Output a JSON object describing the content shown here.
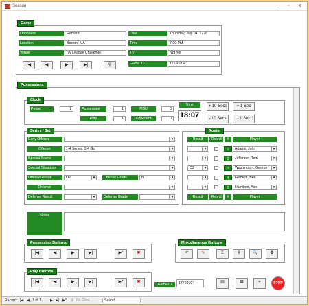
{
  "window": {
    "title": "Season",
    "min": "_",
    "max": "▫",
    "close": "x"
  },
  "game": {
    "tab": "Game",
    "opponent_label": "Opponent",
    "opponent": "Harvard",
    "location_label": "Location",
    "location": "Boston, MA",
    "venue_label": "Venue",
    "venue": "Ivy League Challenge",
    "date_label": "Date",
    "date": "Thursday, July 04, 1776",
    "time_label": "Time",
    "time": "7:00 PM",
    "tv_label": "TV",
    "tv": "Not Yet",
    "gameid_label": "Game ID",
    "gameid": "17760704",
    "nav": {
      "first": "|◀",
      "prev": "◀",
      "next": "▶",
      "last": "▶|",
      "find": "⚲"
    }
  },
  "possessions": {
    "tab": "Possessions"
  },
  "clock": {
    "tab": "Clock",
    "period_label": "Period",
    "period": "1",
    "possession_label": "Possession",
    "possession": "1",
    "play_label": "Play",
    "play": "1",
    "msu_label": "MSU",
    "msu": "0",
    "opponent_label": "Opponent",
    "opponent": "0",
    "time_label": "Time",
    "time": "18:07",
    "plus10": "+ 10 Secs",
    "plus1": "+ 1 Sec",
    "minus10": "- 10 Secs",
    "minus1": "- 1 Sec"
  },
  "series": {
    "tab": "Series / Set",
    "early_offense_label": "Early Offense",
    "early_offense": "",
    "offense_label": "Offense",
    "offense": "1-4 Series, 1-4 Go",
    "special_teams_label": "Special Teams",
    "special_teams": "",
    "special_situations_label": "Special Situations",
    "special_situations": "",
    "offense_result_label": "Offense Result",
    "offense_result": "O2",
    "offense_grade_label": "Offense Grade",
    "offense_grade": "B",
    "defense_label": "Defense",
    "defense": "",
    "defense_result_label": "Defense Result",
    "defense_result": "",
    "defense_grade_label": "Defense Grade",
    "defense_grade": ""
  },
  "roster": {
    "tab": "Roster",
    "headers": {
      "result": "Result",
      "rebnd": "Rebnd",
      "num": "#",
      "player": "Player"
    },
    "rows": [
      {
        "result": "",
        "num": "1",
        "player": "Adams, John"
      },
      {
        "result": "",
        "num": "2",
        "player": "Jefferson, Tom"
      },
      {
        "result": "O2",
        "num": "3",
        "player": "Washington, George"
      },
      {
        "result": "",
        "num": "4",
        "player": "Franklin, Ben"
      },
      {
        "result": "",
        "num": "5",
        "player": "Hamilton, Alex"
      }
    ]
  },
  "notes": {
    "label": "Notes",
    "value": ""
  },
  "possession_buttons": {
    "tab": "Possession Buttons",
    "first": "|◀",
    "prev": "◀",
    "next": "▶",
    "last": "▶|",
    "new": "▶*",
    "delete": "✖"
  },
  "misc_buttons": {
    "tab": "Miscellaneous Buttons",
    "undo": "↶",
    "edit": "✎",
    "sum": "Σ",
    "find": "⚲",
    "zoom": "🔍",
    "help": "❶"
  },
  "play_buttons": {
    "tab": "Play Buttons",
    "first": "|◀",
    "prev": "◀",
    "next": "▶",
    "last": "▶|",
    "new": "▶*",
    "delete": "✖"
  },
  "footer": {
    "gameid_label": "Game ID",
    "gameid": "17760704",
    "stop": "STOP"
  },
  "status": {
    "record_label": "Record:",
    "record": "1 of 1",
    "filter": "No Filter",
    "search": "Search"
  }
}
